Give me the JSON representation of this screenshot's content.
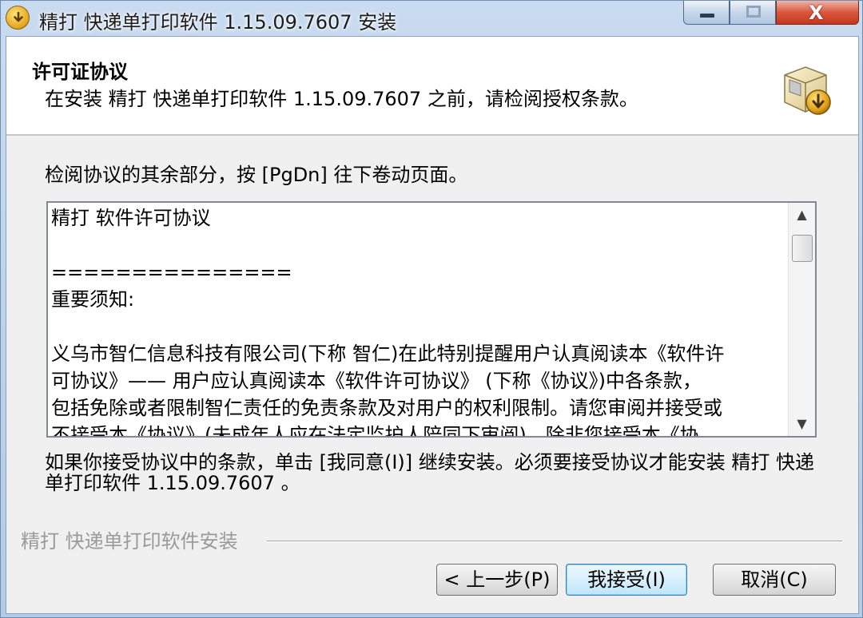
{
  "window": {
    "title": "精打 快递单打印软件 1.15.09.7607 安装",
    "controls": {
      "minimize": "minimize",
      "maximize": "maximize",
      "close": "X"
    }
  },
  "header": {
    "title": "许可证协议",
    "subtitle": "在安装 精打 快递单打印软件 1.15.09.7607 之前，请检阅授权条款。",
    "icon": "installer-box-icon"
  },
  "instruction": "检阅协议的其余部分，按 [PgDn] 往下卷动页面。",
  "license": {
    "lines": [
      "精打 软件许可协议",
      "",
      "===============",
      "重要须知:",
      "",
      "义乌市智仁信息科技有限公司(下称 智仁)在此特别提醒用户认真阅读本《软件许",
      "可协议》—— 用户应认真阅读本《软件许可协议》 (下称《协议》)中各条款，",
      "包括免除或者限制智仁责任的免责条款及对用户的权利限制。请您审阅并接受或",
      "不接受本《协议》(未成年人应在法定监护人陪同下审阅)。除非您接受本《协"
    ]
  },
  "accept_note": "如果你接受协议中的条款，单击 [我同意(I)] 继续安装。必须要接受协议才能安装 精打 快递单打印软件 1.15.09.7607 。",
  "footer": {
    "label": "精打 快递单打印软件安装"
  },
  "buttons": {
    "back": "< 上一步(P)",
    "accept": "我接受(I)",
    "cancel": "取消(C)"
  },
  "scrollbar": {
    "up": "▲",
    "down": "▼"
  },
  "colors": {
    "accent": "#3c7fb1",
    "titlebar": "#b3cbe6",
    "close": "#c2381f"
  }
}
